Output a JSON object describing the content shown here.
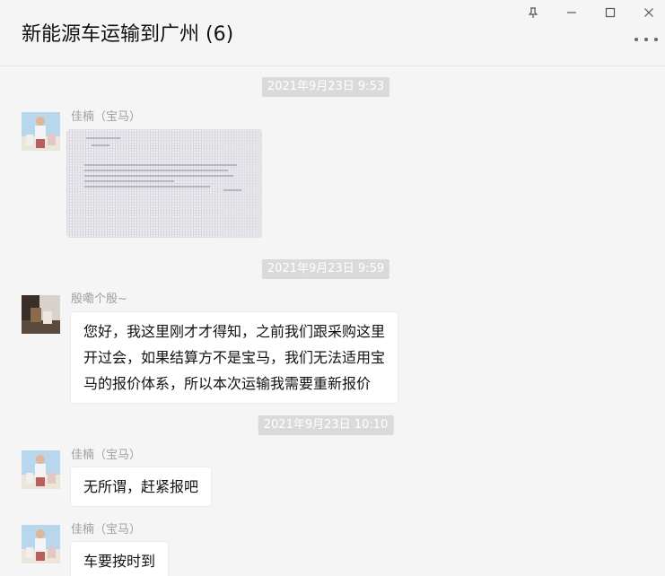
{
  "header": {
    "title": "新能源车运输到广州 (6)"
  },
  "window_controls": {
    "pin": "pin-icon",
    "minimize": "minimize-icon",
    "maximize": "maximize-icon",
    "close": "close-icon",
    "more": "more-icon"
  },
  "messages": [
    {
      "timestamp": "2021年9月23日 9:53",
      "sender": "佳楠（宝马）",
      "type": "image"
    },
    {
      "timestamp": "2021年9月23日 9:59",
      "sender": "殷嘞个殷~",
      "lines": [
        "您好，我这里刚才才得知，之前我们跟采购这里",
        "开过会，如果结算方不是宝马，我们无法适用宝",
        "马的报价体系，所以本次运输我需要重新报价"
      ]
    },
    {
      "timestamp": "2021年9月23日 10:10",
      "sender": "佳楠（宝马）",
      "text": "无所谓，赶紧报吧"
    },
    {
      "sender": "佳楠（宝马）",
      "text": "车要按时到"
    }
  ],
  "colors": {
    "background": "#f5f5f5",
    "bubble": "#ffffff",
    "timestamp_bg": "#dadada",
    "sender_text": "#a0a0a0"
  }
}
